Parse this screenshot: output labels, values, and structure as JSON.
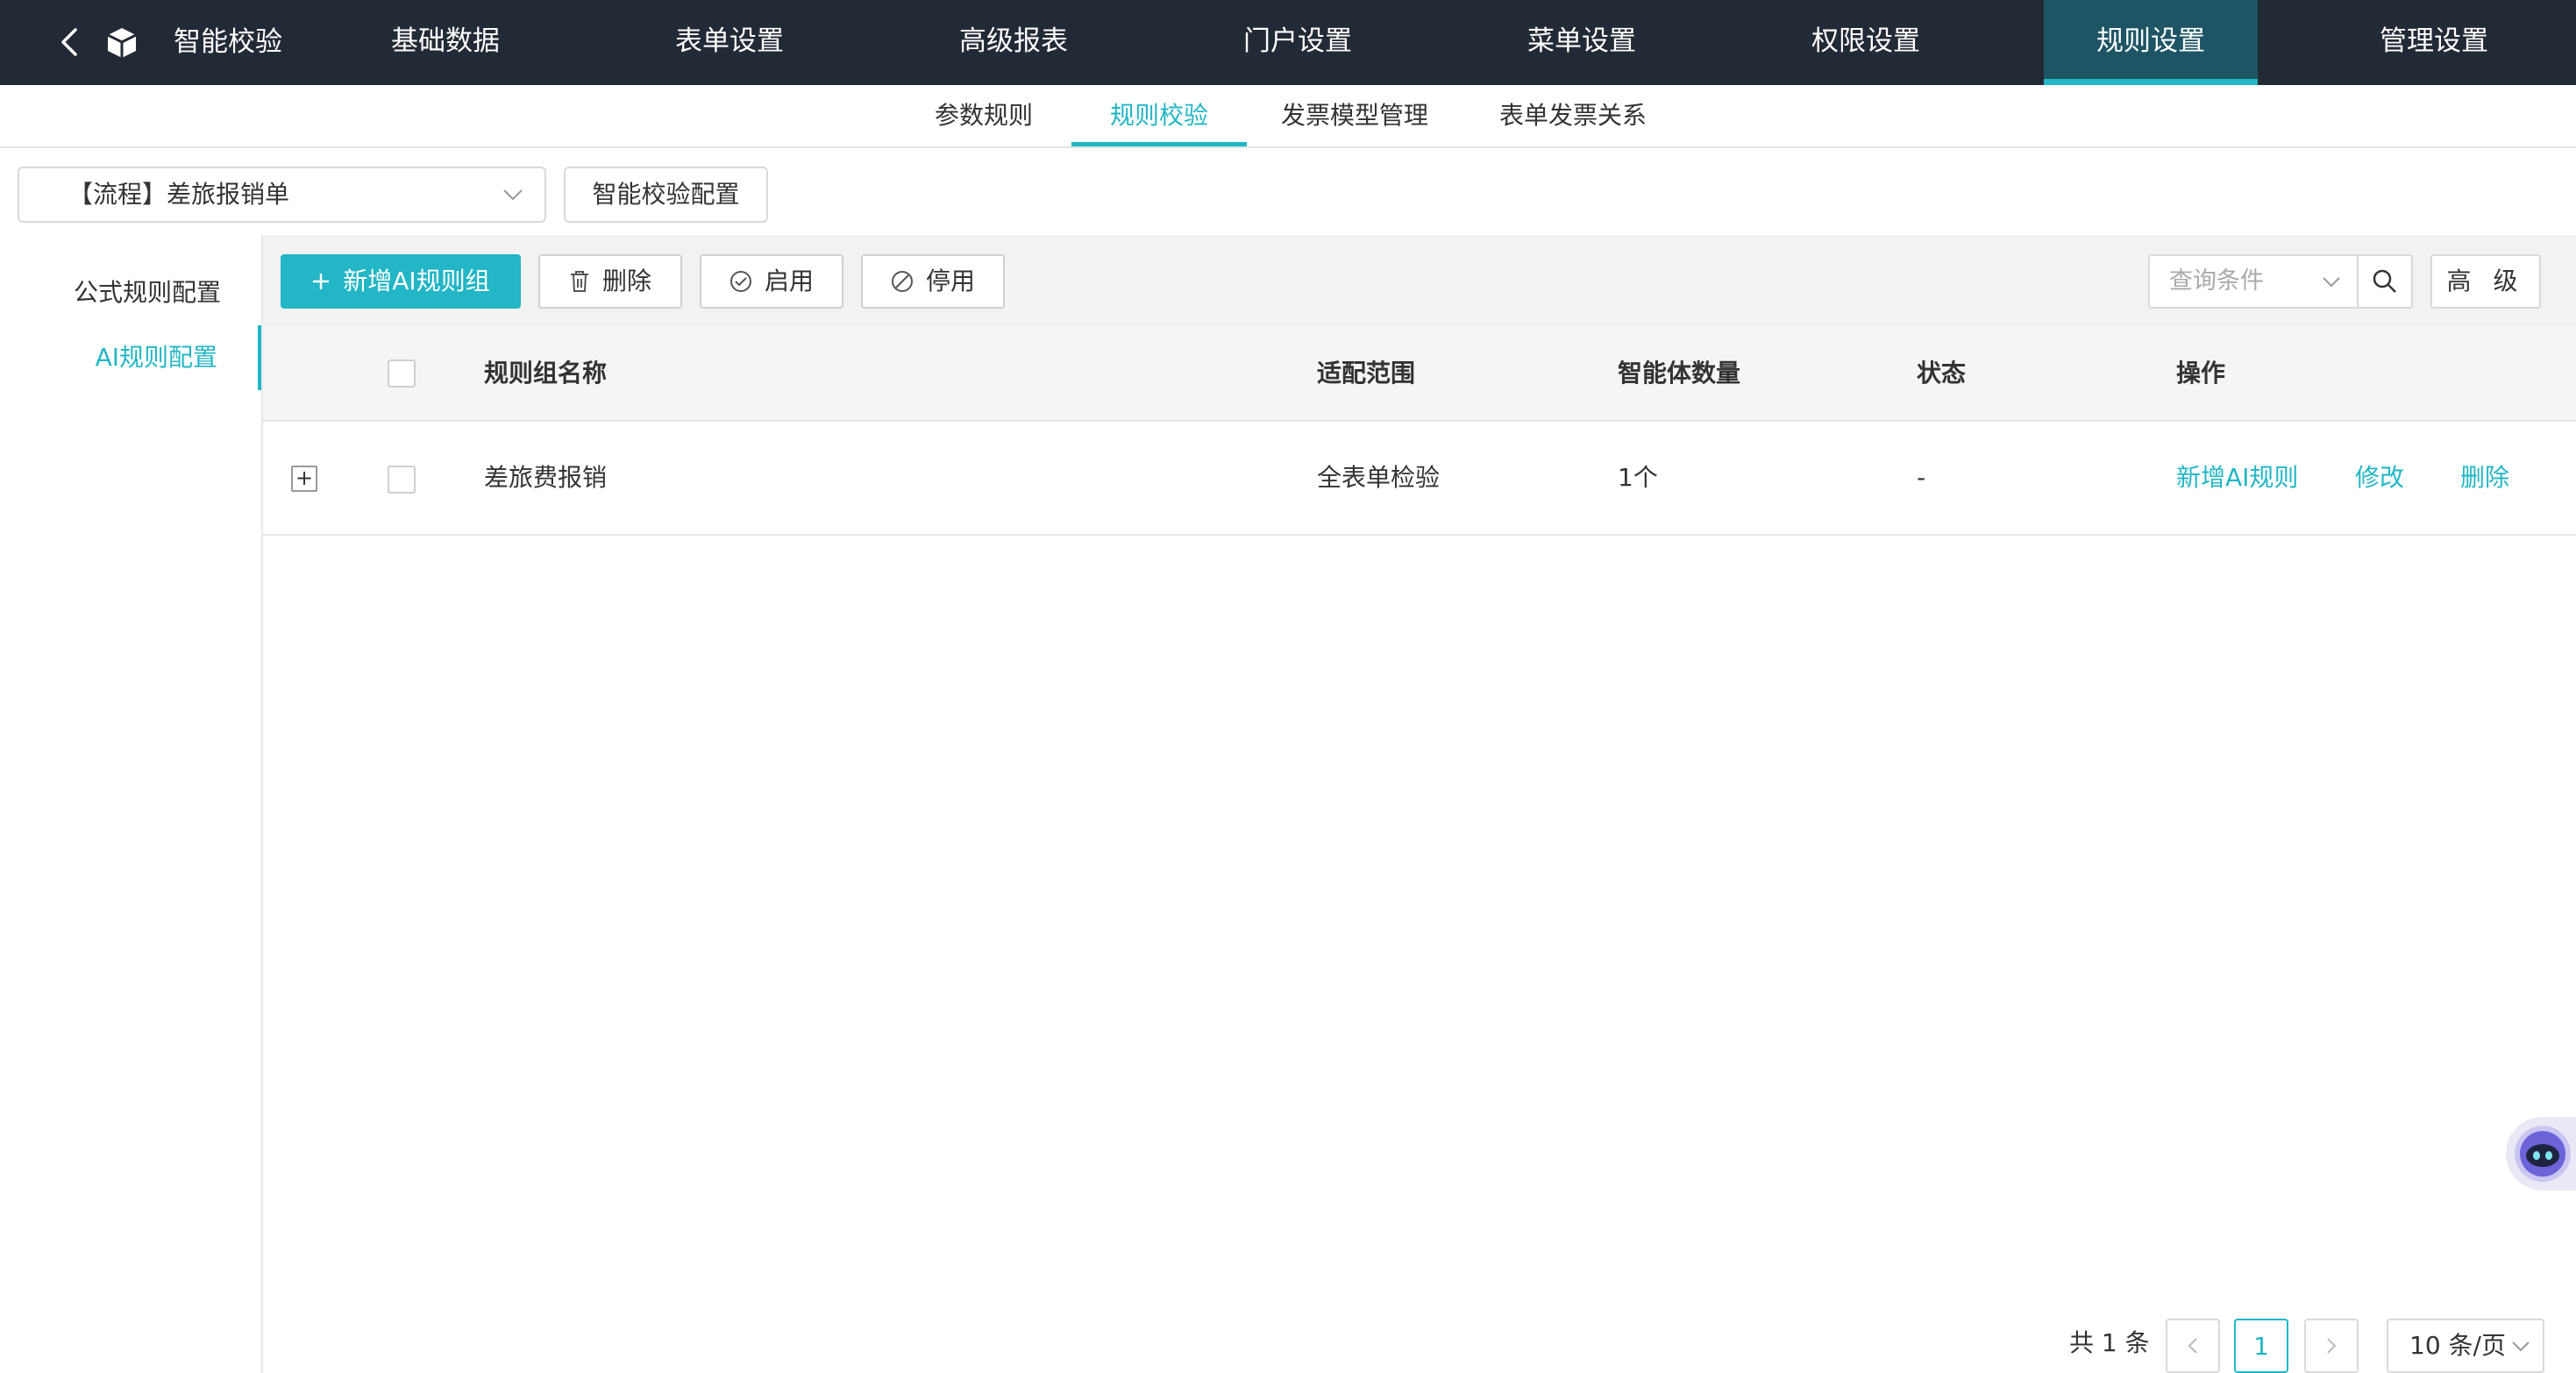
{
  "app": {
    "title": "智能校验",
    "back_icon": "chevron-left-icon",
    "logo_icon": "cube-icon"
  },
  "topnav": {
    "items": [
      "基础数据",
      "表单设置",
      "高级报表",
      "门户设置",
      "菜单设置",
      "权限设置",
      "规则设置",
      "管理设置"
    ],
    "active": "规则设置"
  },
  "subtabs": {
    "items": [
      "参数规则",
      "规则校验",
      "发票模型管理",
      "表单发票关系"
    ],
    "active": "规则校验"
  },
  "form_selector": {
    "value": "【流程】差旅报销单",
    "config_button": "智能校验配置"
  },
  "sidemenu": {
    "items": [
      "公式规则配置",
      "AI规则配置"
    ],
    "active": "AI规则配置"
  },
  "toolbar": {
    "add_label": "新增AI规则组",
    "delete_label": "删除",
    "enable_label": "启用",
    "disable_label": "停用",
    "query_placeholder": "查询条件",
    "advanced_label": "高 级"
  },
  "table": {
    "headers": {
      "name": "规则组名称",
      "scope": "适配范围",
      "agents": "智能体数量",
      "status": "状态",
      "actions": "操作"
    },
    "rows": [
      {
        "name": "差旅费报销",
        "scope": "全表单检验",
        "agents": "1个",
        "status": "-",
        "actions": [
          "新增AI规则",
          "修改",
          "删除"
        ]
      }
    ]
  },
  "pagination": {
    "total": "共 1 条",
    "current_page": "1",
    "page_size": "10 条/页"
  },
  "colors": {
    "accent": "#22b6c6",
    "nav_bg": "#222a35",
    "nav_active_bg": "#1e5565"
  }
}
